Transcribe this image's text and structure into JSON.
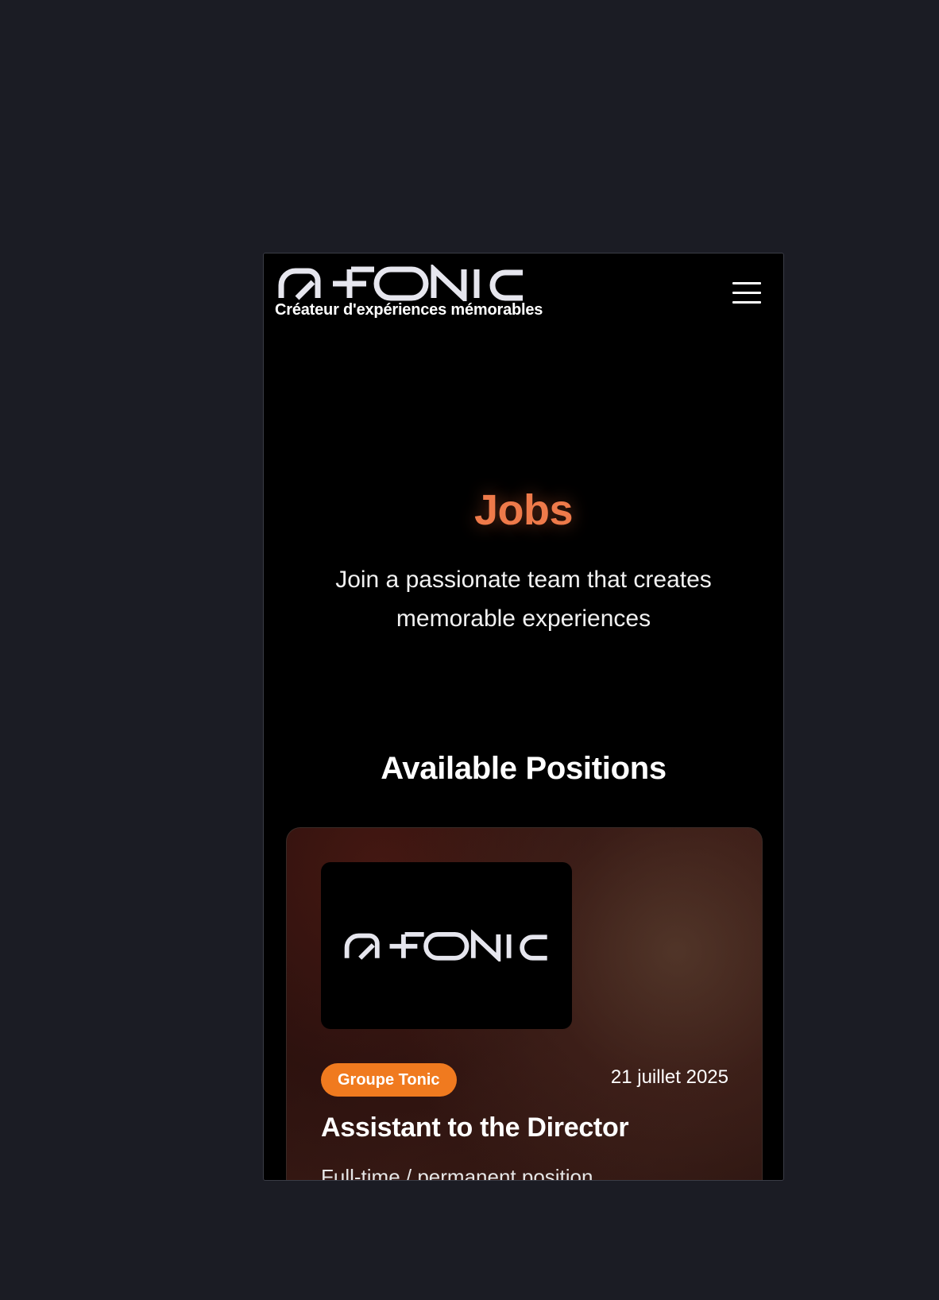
{
  "header": {
    "logo_text": "TONIC",
    "tagline": "Créateur d'expériences mémorables",
    "menu_icon": "hamburger-menu-icon"
  },
  "hero": {
    "title": "Jobs",
    "subtitle": "Join a passionate team that creates memorable experiences"
  },
  "positions": {
    "section_title": "Available Positions",
    "jobs": [
      {
        "company_badge": "Groupe Tonic",
        "date": "21 juillet 2025",
        "title": "Assistant to the Director",
        "type": "Full-time / permanent position",
        "image_logo_text": "TONIC"
      }
    ]
  },
  "colors": {
    "page_background": "#1b1c24",
    "frame_background": "#000000",
    "accent_title": "#ee7a4a",
    "badge": "#f07a1f",
    "text": "#ffffff"
  }
}
